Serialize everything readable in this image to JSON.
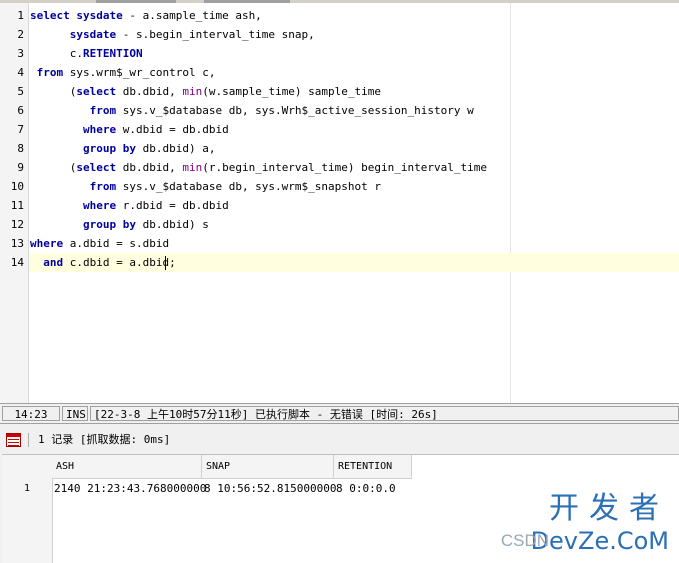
{
  "editor": {
    "line_numbers": [
      "1",
      "2",
      "3",
      "4",
      "5",
      "6",
      "7",
      "8",
      "9",
      "10",
      "11",
      "12",
      "13",
      "14"
    ],
    "lines": [
      [
        {
          "t": "select",
          "c": "kw"
        },
        {
          "t": " "
        },
        {
          "t": "sysdate",
          "c": "kw"
        },
        {
          "t": " - a.sample_time ash,"
        }
      ],
      [
        {
          "t": "      "
        },
        {
          "t": "sysdate",
          "c": "kw"
        },
        {
          "t": " - s.begin_interval_time snap,"
        }
      ],
      [
        {
          "t": "      c."
        },
        {
          "t": "RETENTION",
          "c": "kw"
        }
      ],
      [
        {
          "t": " "
        },
        {
          "t": "from",
          "c": "kw"
        },
        {
          "t": " sys.wrm$_wr_control c,"
        }
      ],
      [
        {
          "t": "      ("
        },
        {
          "t": "select",
          "c": "kw"
        },
        {
          "t": " db.dbid, "
        },
        {
          "t": "min",
          "c": "fn"
        },
        {
          "t": "(w.sample_time) sample_time"
        }
      ],
      [
        {
          "t": "         "
        },
        {
          "t": "from",
          "c": "kw"
        },
        {
          "t": " sys.v_$database db, sys.Wrh$_active_session_history w"
        }
      ],
      [
        {
          "t": "        "
        },
        {
          "t": "where",
          "c": "kw"
        },
        {
          "t": " w.dbid = db.dbid"
        }
      ],
      [
        {
          "t": "        "
        },
        {
          "t": "group by",
          "c": "kw"
        },
        {
          "t": " db.dbid) a,"
        }
      ],
      [
        {
          "t": "      ("
        },
        {
          "t": "select",
          "c": "kw"
        },
        {
          "t": " db.dbid, "
        },
        {
          "t": "min",
          "c": "fn"
        },
        {
          "t": "(r.begin_interval_time) begin_interval_time"
        }
      ],
      [
        {
          "t": "         "
        },
        {
          "t": "from",
          "c": "kw"
        },
        {
          "t": " sys.v_$database db, sys.wrm$_snapshot r"
        }
      ],
      [
        {
          "t": "        "
        },
        {
          "t": "where",
          "c": "kw"
        },
        {
          "t": " r.dbid = db.dbid"
        }
      ],
      [
        {
          "t": "        "
        },
        {
          "t": "group by",
          "c": "kw"
        },
        {
          "t": " db.dbid) s"
        }
      ],
      [
        {
          "t": "where",
          "c": "kw"
        },
        {
          "t": " a.dbid = s.dbid"
        }
      ],
      [
        {
          "t": "  "
        },
        {
          "t": "and",
          "c": "kw"
        },
        {
          "t": " c.dbid = a.dbid;"
        }
      ]
    ]
  },
  "statusbar": {
    "cursor_pos": "14:23",
    "mode": "INS",
    "message": "[22-3-8 上午10时57分11秒] 已执行脚本 - 无错误 [时间: 26s]"
  },
  "results": {
    "record_info": "1 记录 [抓取数据: 0ms]",
    "columns": [
      "ASH",
      "SNAP",
      "RETENTION"
    ],
    "rows": [
      {
        "num": "1",
        "cells": [
          "2140 21:23:43.768000000",
          "8 10:56:52.815000000",
          "8 0:0:0.0"
        ]
      }
    ]
  },
  "watermark": {
    "cn": "开发者",
    "csdn": "CSDN",
    "devze": "DevZe.CoM"
  },
  "colors": {
    "keyword": "#0000a0",
    "function": "#800080",
    "current_line": "#ffffe0",
    "watermark_blue": "#2b6fb6"
  }
}
